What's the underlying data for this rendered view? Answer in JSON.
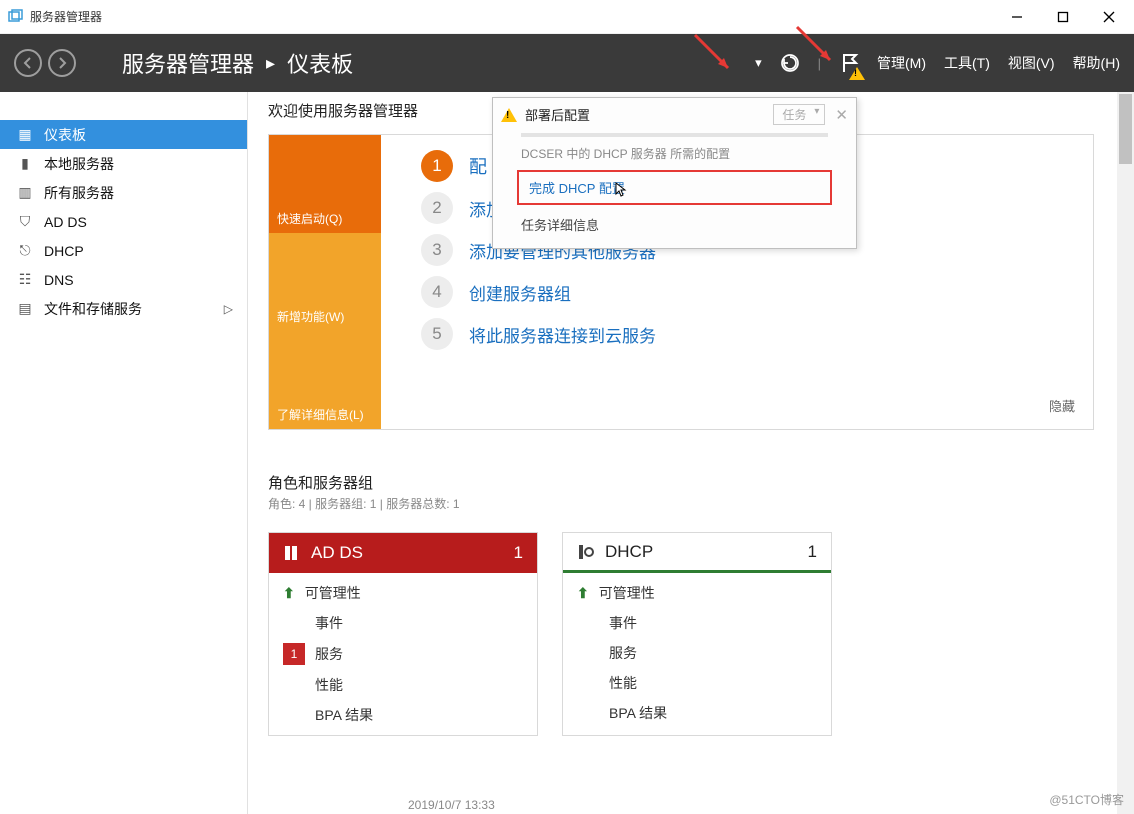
{
  "window": {
    "title": "服务器管理器"
  },
  "header": {
    "breadcrumb1": "服务器管理器",
    "breadcrumb2": "仪表板",
    "menu": [
      "管理(M)",
      "工具(T)",
      "视图(V)",
      "帮助(H)"
    ]
  },
  "sidebar": {
    "items": [
      {
        "icon": "dashboard-icon",
        "label": "仪表板",
        "active": true
      },
      {
        "icon": "server-icon",
        "label": "本地服务器"
      },
      {
        "icon": "servers-icon",
        "label": "所有服务器"
      },
      {
        "icon": "adds-icon",
        "label": "AD DS"
      },
      {
        "icon": "dhcp-icon",
        "label": "DHCP"
      },
      {
        "icon": "dns-icon",
        "label": "DNS"
      },
      {
        "icon": "storage-icon",
        "label": "文件和存储服务",
        "expandable": true
      }
    ]
  },
  "welcome": {
    "heading": "欢迎使用服务器管理器",
    "tiles": {
      "quick_start": "快速启动(Q)",
      "whats_new": "新增功能(W)",
      "learn_more": "了解详细信息(L)"
    },
    "steps": [
      {
        "n": "1",
        "text": "配"
      },
      {
        "n": "2",
        "text": "添加角色和功能"
      },
      {
        "n": "3",
        "text": "添加要管理的其他服务器"
      },
      {
        "n": "4",
        "text": "创建服务器组"
      },
      {
        "n": "5",
        "text": "将此服务器连接到云服务"
      }
    ],
    "hide": "隐藏"
  },
  "roles_section": {
    "title": "角色和服务器组",
    "subtitle": "角色: 4 | 服务器组: 1 | 服务器总数: 1",
    "cards": [
      {
        "kind": "adds",
        "title": "AD DS",
        "count": "1",
        "lines": {
          "manageability": "可管理性",
          "events": "事件",
          "services_badge": "1",
          "services": "服务",
          "performance": "性能",
          "bpa": "BPA 结果"
        }
      },
      {
        "kind": "dhcp",
        "title": "DHCP",
        "count": "1",
        "lines": {
          "manageability": "可管理性",
          "events": "事件",
          "services": "服务",
          "performance": "性能",
          "bpa": "BPA 结果"
        }
      }
    ],
    "timestamp": "2019/10/7 13:33"
  },
  "notification": {
    "title": "部署后配置",
    "tasks_btn": "任务",
    "desc": "DCSER 中的 DHCP 服务器 所需的配置",
    "link": "完成 DHCP 配置",
    "detail": "任务详细信息"
  },
  "watermark": "@51CTO博客"
}
